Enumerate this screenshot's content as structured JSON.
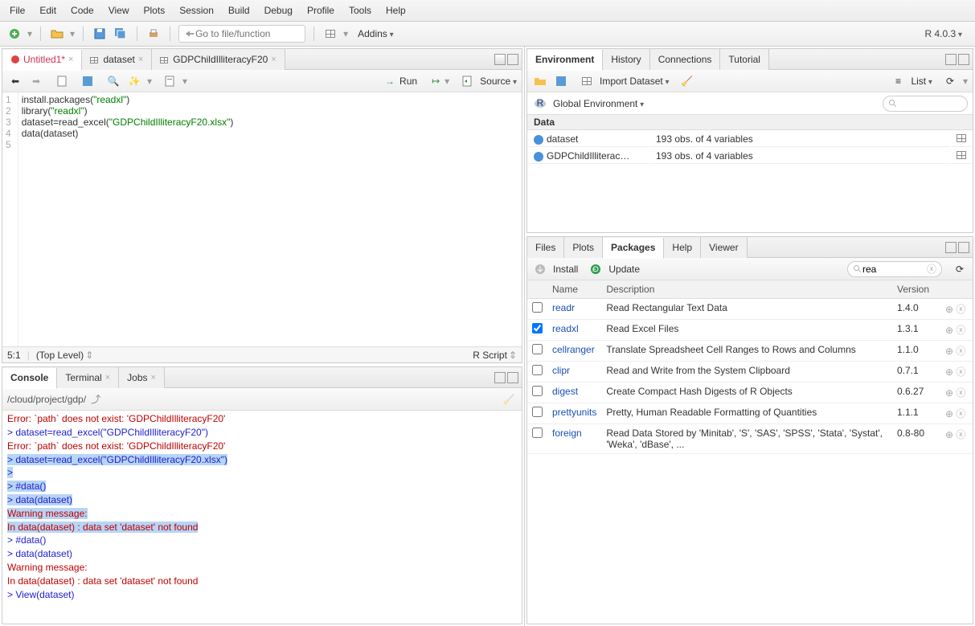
{
  "menu": [
    "File",
    "Edit",
    "Code",
    "View",
    "Plots",
    "Session",
    "Build",
    "Debug",
    "Profile",
    "Tools",
    "Help"
  ],
  "toolbar": {
    "goto_placeholder": "Go to file/function",
    "addins": "Addins",
    "rversion": "R 4.0.3"
  },
  "source": {
    "tabs": [
      {
        "name": "Untitled1*",
        "icon": "rscript"
      },
      {
        "name": "dataset",
        "icon": "table"
      },
      {
        "name": "GDPChildIlliteracyF20",
        "icon": "table"
      }
    ],
    "run_label": "Run",
    "source_label": "Source",
    "code_lines": [
      "install.packages(\"readxl\")",
      "library(\"readxl\")",
      "dataset=read_excel(\"GDPChildIlliteracyF20.xlsx\")",
      "data(dataset)",
      ""
    ],
    "cursor": "5:1",
    "scope": "(Top Level)",
    "mode": "R Script"
  },
  "console": {
    "tabs": [
      "Console",
      "Terminal",
      "Jobs"
    ],
    "path": "/cloud/project/gdp/",
    "lines": [
      {
        "t": "err",
        "s": "Error: `path` does not exist: 'GDPChildIlliteracyF20'"
      },
      {
        "t": "cmd",
        "s": "> dataset=read_excel(\"GDPChildIlliteracyF20\")"
      },
      {
        "t": "err",
        "s": "Error: `path` does not exist: 'GDPChildIlliteracyF20'"
      },
      {
        "t": "cmd hl",
        "s": "> dataset=read_excel(\"GDPChildIlliteracyF20.xlsx\")"
      },
      {
        "t": "hl",
        "s": " "
      },
      {
        "t": "cmd hl",
        "s": "> "
      },
      {
        "t": "cmd hl",
        "s": "> #data()"
      },
      {
        "t": "cmd hl",
        "s": "> data(dataset)"
      },
      {
        "t": "err hl",
        "s": "Warning message:"
      },
      {
        "t": "err hl",
        "s": "In data(dataset) : data set 'dataset' not found"
      },
      {
        "t": "cmd",
        "s": "> #data()"
      },
      {
        "t": "cmd",
        "s": "> data(dataset)"
      },
      {
        "t": "err",
        "s": "Warning message:"
      },
      {
        "t": "err",
        "s": "In data(dataset) : data set 'dataset' not found"
      },
      {
        "t": "cmd",
        "s": "> View(dataset)"
      }
    ]
  },
  "env": {
    "tabs": [
      "Environment",
      "History",
      "Connections",
      "Tutorial"
    ],
    "import_label": "Import Dataset",
    "scope": "Global Environment",
    "view_mode": "List",
    "section": "Data",
    "rows": [
      {
        "name": "dataset",
        "desc": "193 obs. of 4 variables"
      },
      {
        "name": "GDPChildIlliterac…",
        "desc": "193 obs. of 4 variables"
      }
    ]
  },
  "pkgs": {
    "tabs": [
      "Files",
      "Plots",
      "Packages",
      "Help",
      "Viewer"
    ],
    "install": "Install",
    "update": "Update",
    "search": "rea",
    "cols": {
      "name": "Name",
      "desc": "Description",
      "ver": "Version"
    },
    "rows": [
      {
        "checked": false,
        "name": "readr",
        "desc": "Read Rectangular Text Data",
        "ver": "1.4.0"
      },
      {
        "checked": true,
        "name": "readxl",
        "desc": "Read Excel Files",
        "ver": "1.3.1"
      },
      {
        "checked": false,
        "name": "cellranger",
        "desc": "Translate Spreadsheet Cell Ranges to Rows and Columns",
        "ver": "1.1.0"
      },
      {
        "checked": false,
        "name": "clipr",
        "desc": "Read and Write from the System Clipboard",
        "ver": "0.7.1"
      },
      {
        "checked": false,
        "name": "digest",
        "desc": "Create Compact Hash Digests of R Objects",
        "ver": "0.6.27"
      },
      {
        "checked": false,
        "name": "prettyunits",
        "desc": "Pretty, Human Readable Formatting of Quantities",
        "ver": "1.1.1"
      },
      {
        "checked": false,
        "name": "foreign",
        "desc": "Read Data Stored by 'Minitab', 'S', 'SAS', 'SPSS', 'Stata', 'Systat', 'Weka', 'dBase', ...",
        "ver": "0.8-80"
      }
    ]
  }
}
